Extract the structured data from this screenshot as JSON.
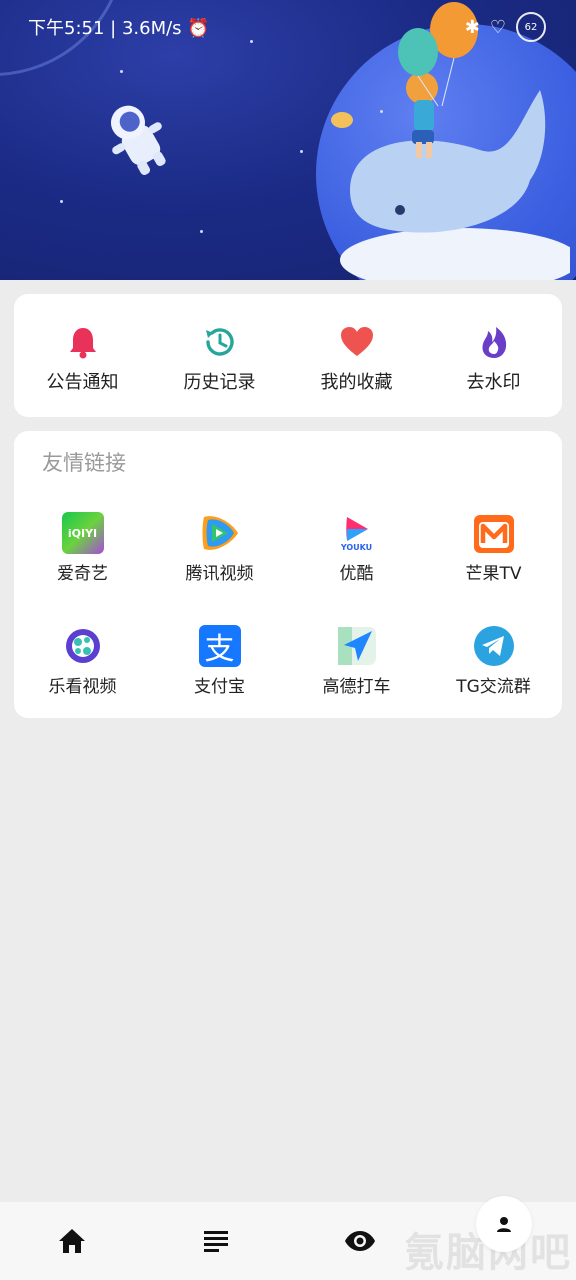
{
  "status_bar": {
    "time": "下午5:51",
    "speed": "3.6M/s",
    "battery": "62"
  },
  "quick_actions": [
    {
      "label": "公告通知",
      "icon": "bell-icon",
      "color": "#e8325a"
    },
    {
      "label": "历史记录",
      "icon": "history-icon",
      "color": "#26a69a"
    },
    {
      "label": "我的收藏",
      "icon": "heart-icon",
      "color": "#ef5350"
    },
    {
      "label": "去水印",
      "icon": "flame-icon",
      "color": "#6a3fc8"
    }
  ],
  "links": {
    "title": "友情链接",
    "items": [
      {
        "label": "爱奇艺",
        "icon": "iqiyi-icon",
        "logo_text": "iQIYI"
      },
      {
        "label": "腾讯视频",
        "icon": "tencent-video-icon"
      },
      {
        "label": "优酷",
        "icon": "youku-icon",
        "logo_text": "YOUKU"
      },
      {
        "label": "芒果TV",
        "icon": "mango-tv-icon"
      },
      {
        "label": "乐看视频",
        "icon": "lekan-icon"
      },
      {
        "label": "支付宝",
        "icon": "alipay-icon",
        "logo_text": "支"
      },
      {
        "label": "高德打车",
        "icon": "amap-icon"
      },
      {
        "label": "TG交流群",
        "icon": "telegram-icon"
      }
    ]
  },
  "bottom_nav": [
    {
      "name": "home-tab",
      "icon": "home-icon"
    },
    {
      "name": "list-tab",
      "icon": "list-icon"
    },
    {
      "name": "eye-tab",
      "icon": "eye-icon"
    },
    {
      "name": "profile-tab",
      "icon": "profile-icon"
    }
  ],
  "watermark": "氪脑网吧"
}
